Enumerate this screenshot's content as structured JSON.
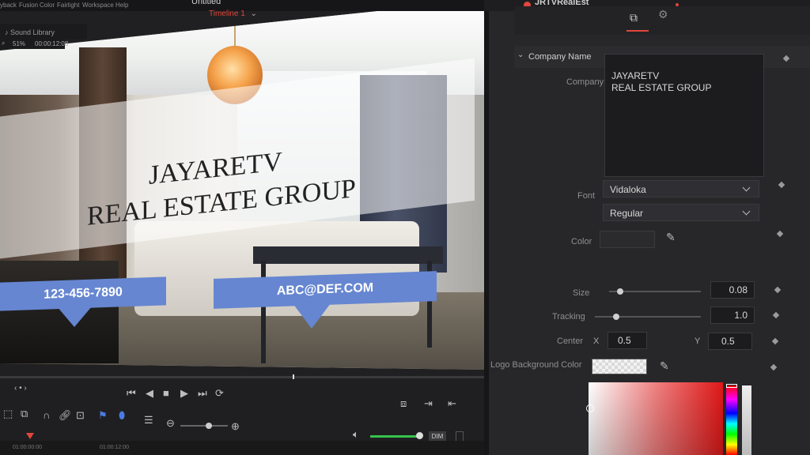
{
  "menubar": {
    "items": [
      "yback",
      "Fusion",
      "Color",
      "Fairlight",
      "Workspace",
      "Help"
    ],
    "document_title": "Untitled",
    "timeline_name": "Timeline 1",
    "sound_library": "Sound Library",
    "zoom": "51%",
    "timecode": "00:00:12:08"
  },
  "viewer": {
    "company_line1": "JAYARETV",
    "company_line2": "REAL ESTATE GROUP",
    "phone": "123-456-7890",
    "email": "ABC@DEF.COM"
  },
  "timeline": {
    "ruler_marks": [
      "01:00:00:00",
      "01:00:12:00"
    ]
  },
  "inspector": {
    "title": "JRTVRealEst",
    "section": "Company Name",
    "company_label": "Company",
    "company_value_line1": "JAYARETV",
    "company_value_line2": "REAL ESTATE GROUP",
    "font_label": "Font",
    "font_value": "Vidaloka",
    "style_value": "Regular",
    "color_label": "Color",
    "size_label": "Size",
    "size_value": "0.08",
    "size_level": 0.12,
    "tracking_label": "Tracking",
    "tracking_value": "1.0",
    "tracking_level": 0.2,
    "center_label": "Center",
    "center_x_label": "X",
    "center_x_value": "0.5",
    "center_y_label": "Y",
    "center_y_value": "0.5",
    "logo_bg_label": "Logo Background Color",
    "dim_label": "DIM"
  },
  "colors": {
    "accent": "#e0463c",
    "badge": "#6686d1",
    "volume": "#37c24b"
  }
}
